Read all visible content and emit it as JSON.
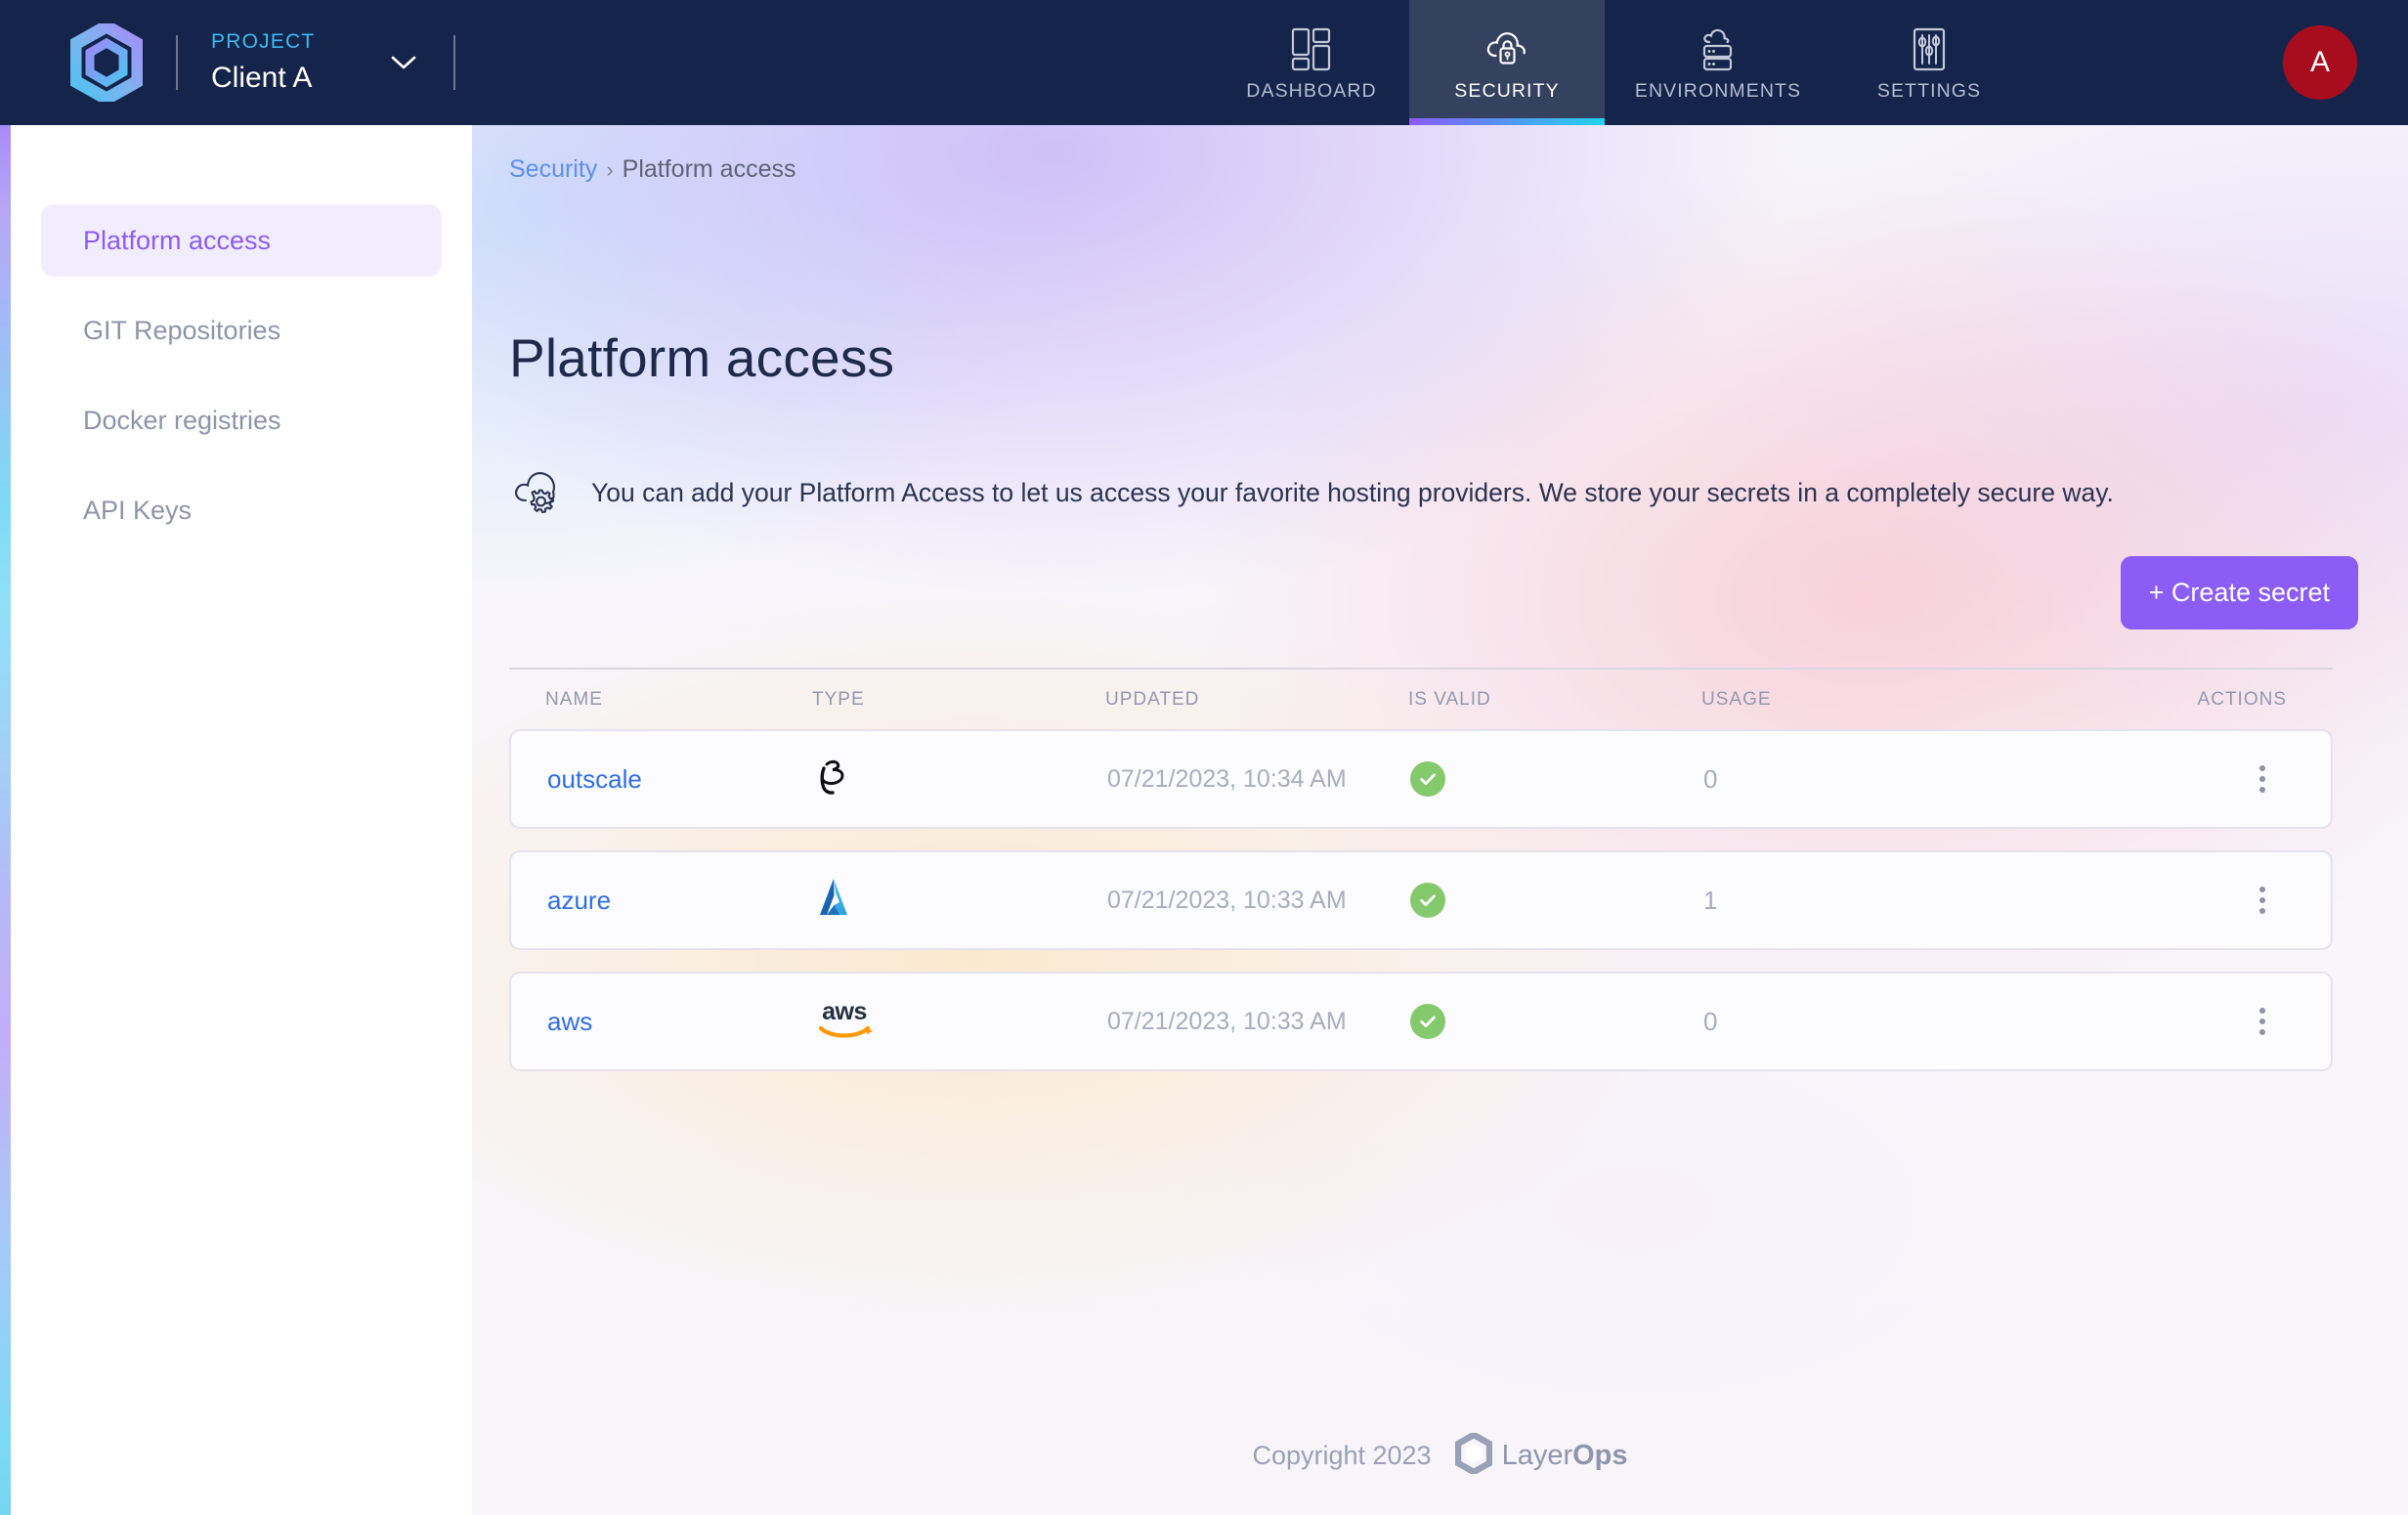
{
  "topbar": {
    "logo_icon": "layerops-hexagon-logo",
    "project_kicker": "PROJECT",
    "project_name": "Client A",
    "project_chevron_icon": "chevron-down-icon",
    "avatar_initial": "A",
    "avatar_color": "#a80d1e",
    "background": "#15244b",
    "tabs": [
      {
        "label": "DASHBOARD",
        "icon": "dashboard-grid-icon",
        "active": false
      },
      {
        "label": "SECURITY",
        "icon": "cloud-lock-icon",
        "active": true
      },
      {
        "label": "ENVIRONMENTS",
        "icon": "cloud-server-icon",
        "active": false
      },
      {
        "label": "SETTINGS",
        "icon": "sliders-icon",
        "active": false
      }
    ],
    "active_tab_gradient": [
      "#8b5cf6",
      "#22d3ee"
    ]
  },
  "sidebar": {
    "items": [
      {
        "label": "Platform access",
        "active": true
      },
      {
        "label": "GIT Repositories",
        "active": false
      },
      {
        "label": "Docker registries",
        "active": false
      },
      {
        "label": "API Keys",
        "active": false
      }
    ],
    "active_color": "#8b5cf6",
    "active_background": "#f2edfe"
  },
  "main": {
    "breadcrumb": {
      "root": "Security",
      "separator": "›",
      "current": "Platform access"
    },
    "page_title": "Platform access",
    "description_icon": "cloud-gear-icon",
    "description": "You can add your Platform Access to let us access your favorite hosting providers. We store your secrets in a completely secure way.",
    "create_button": {
      "label": "+ Create secret",
      "color": "#8b5cf6"
    },
    "table": {
      "columns": [
        "NAME",
        "TYPE",
        "UPDATED",
        "IS VALID",
        "USAGE",
        "ACTIONS"
      ],
      "rows": [
        {
          "name": "outscale",
          "type_icon": "outscale-3ds-logo",
          "updated": "07/21/2023, 10:34 AM",
          "is_valid": true,
          "valid_icon": "check-circle-icon",
          "usage": "0",
          "actions_icon": "kebab-menu-icon"
        },
        {
          "name": "azure",
          "type_icon": "azure-logo",
          "updated": "07/21/2023, 10:33 AM",
          "is_valid": true,
          "valid_icon": "check-circle-icon",
          "usage": "1",
          "actions_icon": "kebab-menu-icon"
        },
        {
          "name": "aws",
          "type_icon": "aws-logo",
          "updated": "07/21/2023, 10:33 AM",
          "is_valid": true,
          "valid_icon": "check-circle-icon",
          "usage": "0",
          "actions_icon": "kebab-menu-icon"
        }
      ]
    }
  },
  "footer": {
    "copyright": "Copyright 2023",
    "brand_logo_icon": "layerops-hexagon-logo",
    "brand_name_light": "Layer",
    "brand_name_bold": "Ops"
  }
}
